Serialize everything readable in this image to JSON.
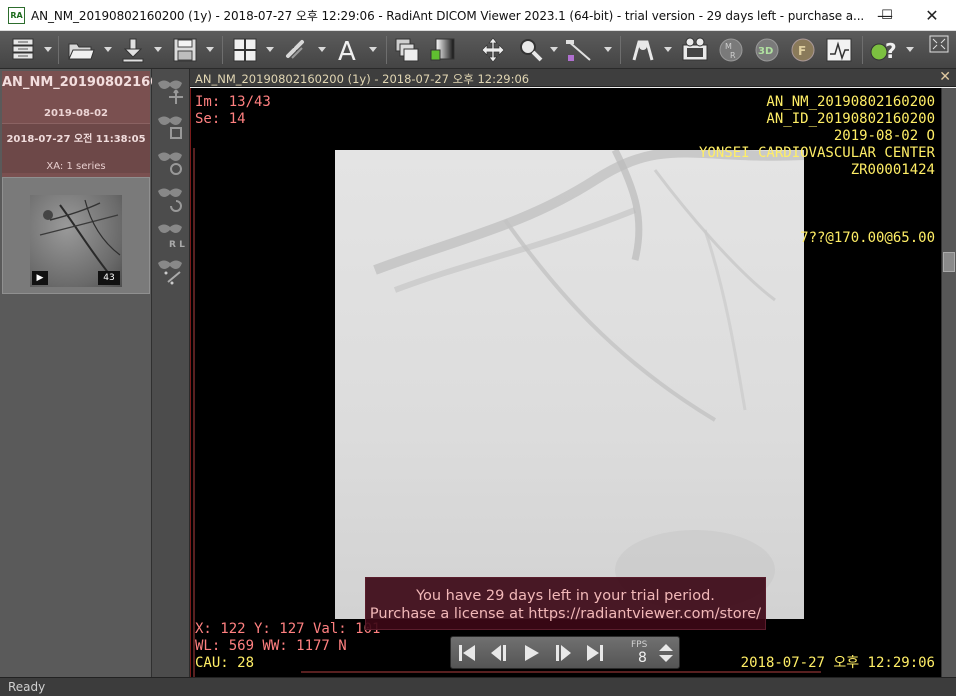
{
  "window": {
    "app_icon_text": "RA",
    "title": "AN_NM_20190802160200 (1y) - 2018-07-27 오후 12:29:06 - RadiAnt DICOM Viewer 2023.1 (64-bit) - trial version - 29 days left - purchase a...",
    "minimize_label": "—",
    "maximize_label": "☐",
    "close_label": "✕"
  },
  "toolbar": {
    "icons": [
      "database-icon",
      "open-folder-icon",
      "download-icon",
      "save-icon",
      "layout-icon",
      "link-icon",
      "text-annotation-icon",
      "series-stack-icon",
      "window-level-icon",
      "pan-icon",
      "zoom-icon",
      "measure-icon",
      "fusion-icon",
      "cine-icon",
      "mpr-icon",
      "3d-icon",
      "fusion-f-icon",
      "ecg-icon",
      "help-icon",
      "fullscreen-icon"
    ]
  },
  "patient": {
    "name": "AN_NM_20190802160200",
    "date": "2019-08-02"
  },
  "study": {
    "datetime": "2018-07-27 오전 11:38:05",
    "series_summary": "XA: 1 series"
  },
  "series": {
    "image_count": "43",
    "play_glyph": "▶"
  },
  "viewer": {
    "header": "AN_NM_20190802160200  (1y) - 2018-07-27 오후 12:29:06",
    "close_glyph": "✕"
  },
  "overlay": {
    "image_index": "Im: 13/43",
    "series_number": "Se: 14",
    "patient_name": "AN_NM_20190802160200",
    "patient_id": "AN_ID_20190802160200",
    "birth": "2019-08-02 O",
    "institution": "YONSEI CARDIOVASCULAR  CENTER",
    "accession": "ZR00001424",
    "geometry": "7??@170.00@65.00",
    "cursor": "X: 122 Y: 127 Val: 101",
    "window": "WL: 569 WW: 1177 N",
    "cau": "CAU: 28",
    "acq_datetime": "2018-07-27 오후 12:29:06"
  },
  "trial": {
    "line1": "You have 29 days left in your trial period.",
    "line2": "Purchase a license at https://radiantviewer.com/store/"
  },
  "cine": {
    "fps_label": "FPS",
    "fps_value": "8"
  },
  "status": {
    "text": "Ready"
  },
  "colors": {
    "overlay_left": "#ff8080",
    "overlay_right": "#ffee66",
    "patient_bg": "#7a5050",
    "trial_bg": "#3c0816"
  }
}
